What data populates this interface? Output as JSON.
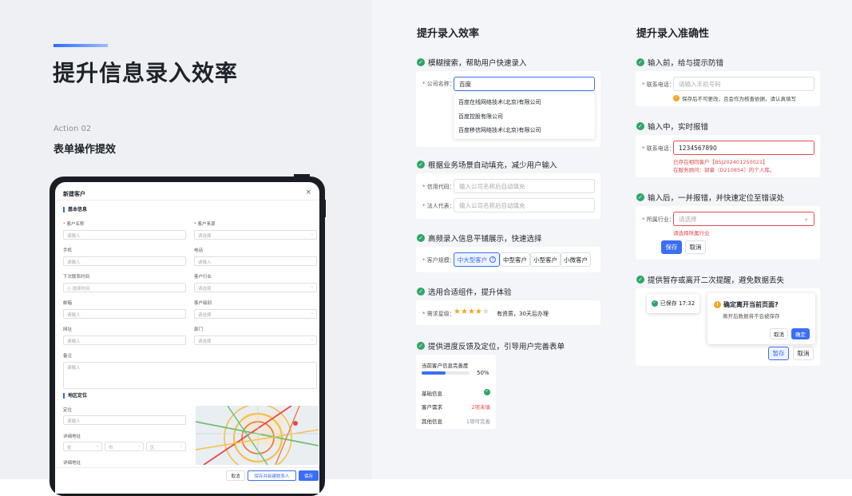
{
  "left": {
    "headline": "提升信息录入效率",
    "action_label": "Action 02",
    "subheadline": "表单操作提效"
  },
  "tablet": {
    "dialog_title": "新建客户",
    "close_icon": "×",
    "section_basic": "基本信息",
    "fields": {
      "customer_name_label": "客户名称",
      "customer_name_ph": "请输入",
      "source_label": "客户来源",
      "source_ph": "请选择",
      "phone_label": "手机",
      "phone_ph": "请输入",
      "tel_label": "电话",
      "tel_ph": "请输入",
      "next_contact_label": "下次联系时间",
      "next_contact_ph": "选择时间",
      "industry_label": "客户行业",
      "industry_ph": "请选择",
      "email_label": "邮箱",
      "email_ph": "请输入",
      "level_label": "客户级别",
      "level_ph": "请选择",
      "website_label": "网址",
      "website_ph": "请输入",
      "dept_label": "部门",
      "dept_ph": "请选择",
      "remark_label": "备注",
      "remark_ph": "请输入"
    },
    "section_region": "地区定位",
    "region": {
      "locate_label": "定位",
      "locate_ph": "请输入",
      "detail_label": "详细地址",
      "province_ph": "省",
      "city_ph": "市",
      "district_ph": "区",
      "detail2_label": "详细地址"
    },
    "footer": {
      "cancel": "取消",
      "save_new": "保存并新建联系人",
      "save": "保存"
    }
  },
  "efficiency": {
    "title": "提升录入效率",
    "feature1": "模糊搜索，帮助用户快速录入",
    "company_label": "公司名称：",
    "company_value": "百度",
    "suggestions": [
      "百度在线网络技术(北京)有限公司",
      "百度控股有限公司",
      "百度移信网络技术(北京)有限公司"
    ],
    "feature2": "根据业务场景自动填充，减少用户输入",
    "credit_label": "信用代码：",
    "credit_ph": "输入公司名称后自动填充",
    "legal_label": "法人代表：",
    "legal_ph": "输入公司名称后自动填充",
    "feature3": "高频录入信息平铺展示，快速选择",
    "scale_label": "客户规模：",
    "scale_options": [
      "中大型客户",
      "中型客户",
      "小型客户",
      "小微客户"
    ],
    "feature4": "选用合适组件，提升体验",
    "demand_label": "需求星级：",
    "rating": 4,
    "rating_max": 5,
    "rating_text": "有资质，30天后办理",
    "feature5": "提供进度反馈及定位，引导用户完善表单",
    "progress_title": "当前客户信息完善度",
    "progress_percent": 50,
    "progress_text": "50%",
    "progress_rows": [
      {
        "label": "基础信息",
        "status": ""
      },
      {
        "label": "客户需求",
        "status": "2项未填"
      },
      {
        "label": "其他信息",
        "status": "1项可完善"
      }
    ]
  },
  "accuracy": {
    "title": "提升录入准确性",
    "feature1": "输入前，给与提示防错",
    "phone_label": "联系电话：",
    "phone_ph": "请输入手机号码",
    "phone_hint": "保存后不可更改，且会作为核查依据，请认真填写",
    "feature2": "输入中，实时报错",
    "phone2_label": "联系电话：",
    "phone2_value": "1234567890",
    "error_line1": "已存在相同客户【BSJ202401250021】",
    "error_line2": "在服务顾问：郭睿（D210854）的个人库。",
    "feature3": "输入后，一并报错，并快速定位至错误处",
    "industry_label": "所属行业：",
    "industry_ph": "请选择",
    "industry_error": "请选择所属行业",
    "save": "保存",
    "cancel": "取消",
    "feature4": "提供暂存或离开二次提醒，避免数据丢失",
    "saved_toast": "已保存 17:32",
    "confirm_title": "确定离开当前页面?",
    "confirm_desc": "离开后数据将不会被保存",
    "confirm_cancel": "取消",
    "confirm_ok": "确定",
    "draft": "暂存",
    "cancel2": "取消"
  },
  "colors": {
    "primary": "#3b6ef5",
    "success": "#2ea664",
    "error": "#e5484d",
    "warning": "#f5a623",
    "star": "#f5a623"
  }
}
